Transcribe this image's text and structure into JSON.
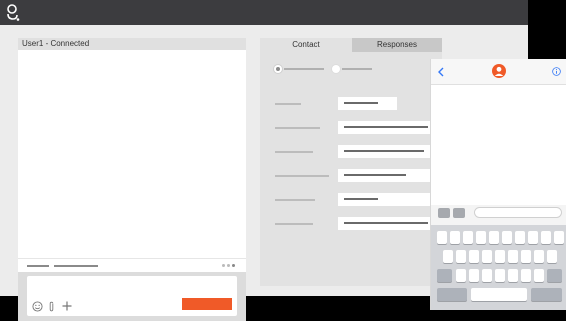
{
  "colors": {
    "topbar": "#3c3c3f",
    "desktop": "#ececec",
    "accent": "#f05a28",
    "ios_blue": "#3478f6"
  },
  "topbar": {
    "logo_icon": "genesys-logo-icon"
  },
  "chat": {
    "title": "User1 - Connected",
    "send_button_label": "",
    "icons": [
      "emoji-icon",
      "paperclip-icon",
      "plus-icon"
    ]
  },
  "contact_panel": {
    "tabs": [
      {
        "label": "Contact",
        "selected": true
      },
      {
        "label": "Responses",
        "selected": false
      }
    ]
  },
  "phone": {
    "icons": [
      "back-chevron-icon",
      "agent-avatar-icon",
      "info-icon"
    ]
  }
}
